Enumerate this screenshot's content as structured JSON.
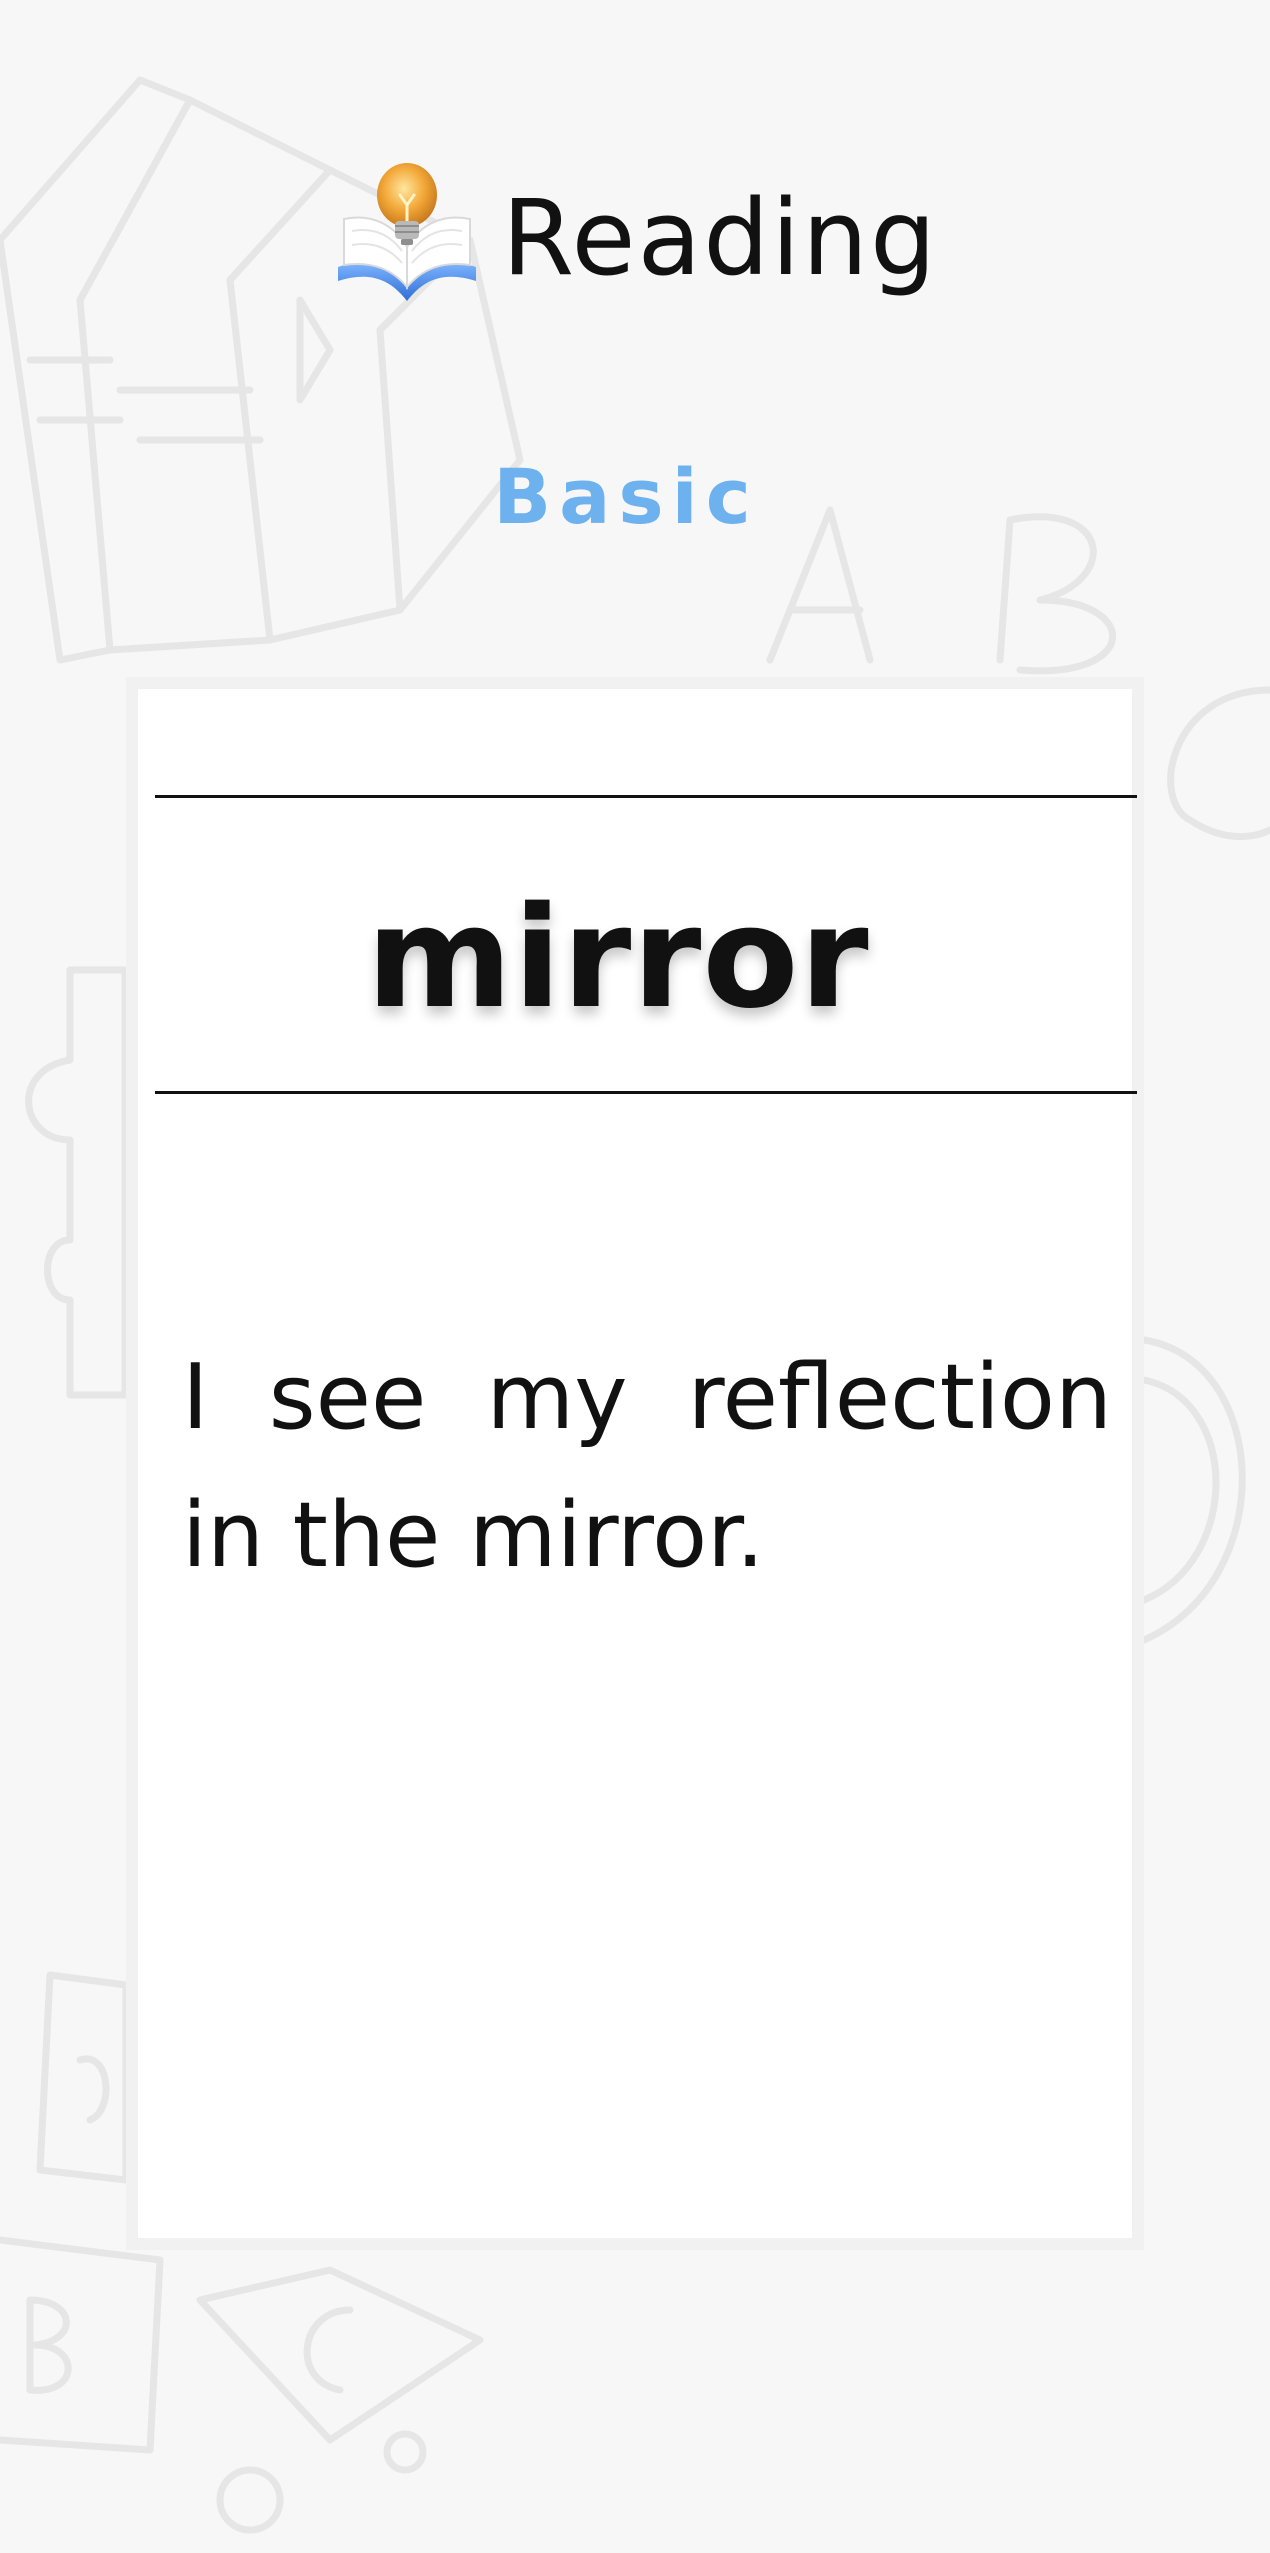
{
  "header": {
    "title": "Reading",
    "logo_icon": "book-lightbulb-icon"
  },
  "level": {
    "label": "Basic",
    "color": "#6db2ee"
  },
  "card": {
    "word": "mirror",
    "sentence": "I see my reflection in the mirror."
  },
  "background": {
    "doodles": [
      "books-doodle",
      "letters-doodle",
      "puzzle-doodle",
      "magnet-doodle",
      "blocks-doodle"
    ]
  }
}
